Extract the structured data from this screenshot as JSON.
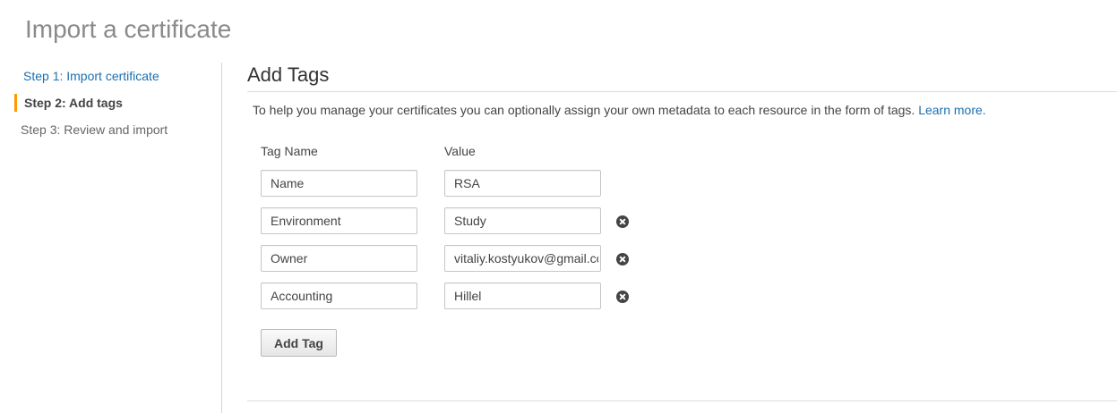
{
  "page": {
    "title": "Import a certificate"
  },
  "steps": [
    {
      "label": "Step 1: Import certificate",
      "state": "link"
    },
    {
      "label": "Step 2: Add tags",
      "state": "active"
    },
    {
      "label": "Step 3: Review and import",
      "state": "pending"
    }
  ],
  "main": {
    "section_title": "Add Tags",
    "description": "To help you manage your certificates you can optionally assign your own metadata to each resource in the form of tags.",
    "learn_more": "Learn more.",
    "col_tag_name": "Tag Name",
    "col_value": "Value"
  },
  "tags": [
    {
      "name": "Name",
      "value": "RSA",
      "removable": false
    },
    {
      "name": "Environment",
      "value": "Study",
      "removable": true
    },
    {
      "name": "Owner",
      "value": "vitaliy.kostyukov@gmail.com",
      "removable": true
    },
    {
      "name": "Accounting",
      "value": "Hillel",
      "removable": true
    }
  ],
  "add_tag_label": "Add Tag",
  "colors": {
    "link": "#1a6fb0",
    "active_marker": "#ff9900",
    "title_gray": "#8a8a8a"
  },
  "icons": {
    "remove": "close-circle-icon"
  }
}
